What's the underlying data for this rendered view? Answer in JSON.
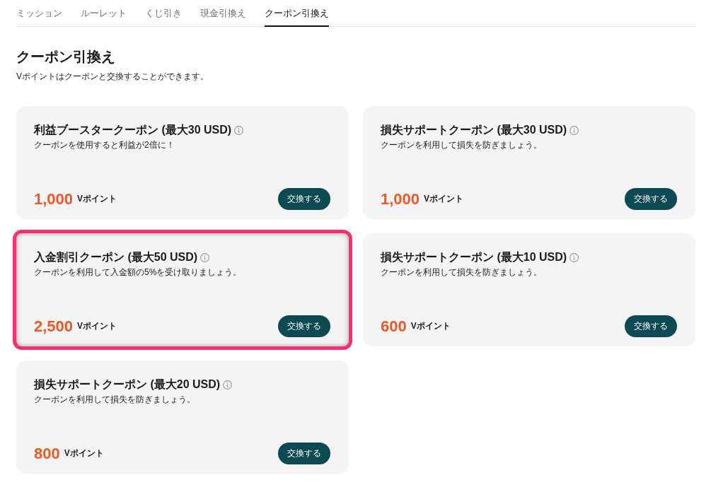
{
  "tabs": [
    {
      "label": "ミッション",
      "selected": false
    },
    {
      "label": "ルーレット",
      "selected": false
    },
    {
      "label": "くじ引き",
      "selected": false
    },
    {
      "label": "現金引換え",
      "selected": false
    },
    {
      "label": "クーポン引換え",
      "selected": true
    }
  ],
  "page": {
    "title": "クーポン引換え",
    "subtitle": "Vポイントはクーポンと交換することができます。"
  },
  "coupons": [
    {
      "title": "利益ブースタークーポン (最大30 USD)",
      "description": "クーポンを使用すると利益が2倍に！",
      "points": "1,000",
      "unit": "Vポイント",
      "button": "交換する",
      "highlighted": false
    },
    {
      "title": "損失サポートクーポン (最大30 USD)",
      "description": "クーポンを利用して損失を防ぎましょう。",
      "points": "1,000",
      "unit": "Vポイント",
      "button": "交換する",
      "highlighted": false
    },
    {
      "title": "入金割引クーポン (最大50 USD)",
      "description": "クーポンを利用して入金額の5%を受け取りましょう。",
      "points": "2,500",
      "unit": "Vポイント",
      "button": "交換する",
      "highlighted": true
    },
    {
      "title": "損失サポートクーポン (最大10 USD)",
      "description": "クーポンを利用して損失を防ぎましょう。",
      "points": "600",
      "unit": "Vポイント",
      "button": "交換する",
      "highlighted": false
    },
    {
      "title": "損失サポートクーポン (最大20 USD)",
      "description": "クーポンを利用して損失を防ぎましょう。",
      "points": "800",
      "unit": "Vポイント",
      "button": "交換する",
      "highlighted": false
    }
  ]
}
